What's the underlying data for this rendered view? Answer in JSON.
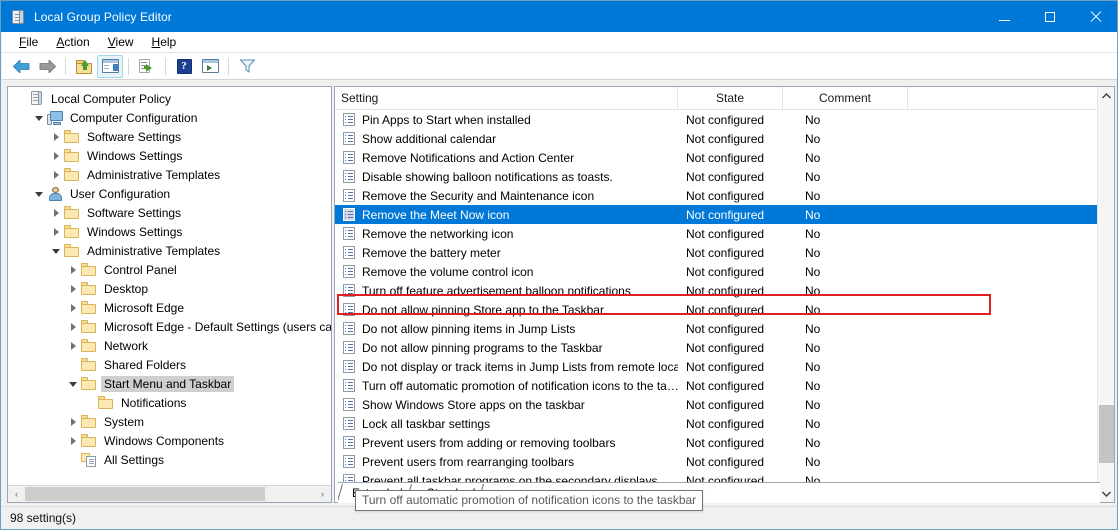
{
  "window": {
    "title": "Local Group Policy Editor",
    "icon": "gpedit-scroll-icon",
    "controls": {
      "minimize": "minimize-icon",
      "maximize": "maximize-icon",
      "close": "close-icon"
    },
    "accent": "#0078d7"
  },
  "menubar": {
    "items": [
      {
        "label": "File",
        "accel": "F"
      },
      {
        "label": "Action",
        "accel": "A"
      },
      {
        "label": "View",
        "accel": "V"
      },
      {
        "label": "Help",
        "accel": "H"
      }
    ]
  },
  "toolbar": {
    "buttons": [
      {
        "name": "back-arrow-icon",
        "tip": "Back"
      },
      {
        "name": "forward-arrow-icon",
        "tip": "Forward"
      },
      {
        "name": "up-one-level-icon",
        "tip": "Up one level"
      },
      {
        "name": "show-hide-console-tree-icon",
        "tip": "Show/Hide Console Tree",
        "active": true
      },
      {
        "name": "export-list-icon",
        "tip": "Export List"
      },
      {
        "name": "help-icon",
        "tip": "Help",
        "glyph": "?"
      },
      {
        "name": "show-action-pane-icon",
        "tip": "Show/Hide Action Pane"
      },
      {
        "name": "filter-icon",
        "tip": "Filter"
      }
    ]
  },
  "tree": {
    "nodes": [
      {
        "label": "Local Computer Policy",
        "depth": 0,
        "icon": "scroll-icon",
        "expander": "none",
        "selected": false
      },
      {
        "label": "Computer Configuration",
        "depth": 1,
        "icon": "computer-icon",
        "expander": "open",
        "selected": false
      },
      {
        "label": "Software Settings",
        "depth": 2,
        "icon": "folder-icon",
        "expander": "closed",
        "selected": false
      },
      {
        "label": "Windows Settings",
        "depth": 2,
        "icon": "folder-icon",
        "expander": "closed",
        "selected": false
      },
      {
        "label": "Administrative Templates",
        "depth": 2,
        "icon": "folder-icon",
        "expander": "closed",
        "selected": false
      },
      {
        "label": "User Configuration",
        "depth": 1,
        "icon": "user-icon",
        "expander": "open",
        "selected": false
      },
      {
        "label": "Software Settings",
        "depth": 2,
        "icon": "folder-icon",
        "expander": "closed",
        "selected": false
      },
      {
        "label": "Windows Settings",
        "depth": 2,
        "icon": "folder-icon",
        "expander": "closed",
        "selected": false
      },
      {
        "label": "Administrative Templates",
        "depth": 2,
        "icon": "folder-icon",
        "expander": "open",
        "selected": false
      },
      {
        "label": "Control Panel",
        "depth": 3,
        "icon": "folder-icon",
        "expander": "closed",
        "selected": false
      },
      {
        "label": "Desktop",
        "depth": 3,
        "icon": "folder-icon",
        "expander": "closed",
        "selected": false
      },
      {
        "label": "Microsoft Edge",
        "depth": 3,
        "icon": "folder-icon",
        "expander": "closed",
        "selected": false
      },
      {
        "label": "Microsoft Edge - Default Settings (users can c",
        "depth": 3,
        "icon": "folder-icon",
        "expander": "closed",
        "selected": false
      },
      {
        "label": "Network",
        "depth": 3,
        "icon": "folder-icon",
        "expander": "closed",
        "selected": false
      },
      {
        "label": "Shared Folders",
        "depth": 3,
        "icon": "folder-icon",
        "expander": "none",
        "selected": false
      },
      {
        "label": "Start Menu and Taskbar",
        "depth": 3,
        "icon": "folder-icon",
        "expander": "open",
        "selected": true
      },
      {
        "label": "Notifications",
        "depth": 4,
        "icon": "folder-icon",
        "expander": "none",
        "selected": false
      },
      {
        "label": "System",
        "depth": 3,
        "icon": "folder-icon",
        "expander": "closed",
        "selected": false
      },
      {
        "label": "Windows Components",
        "depth": 3,
        "icon": "folder-icon",
        "expander": "closed",
        "selected": false
      },
      {
        "label": "All Settings",
        "depth": 3,
        "icon": "all-settings-icon",
        "expander": "none",
        "selected": false
      }
    ],
    "hscroll": {
      "left_arrow": "‹",
      "right_arrow": "›"
    }
  },
  "list": {
    "columns": [
      "Setting",
      "State",
      "Comment"
    ],
    "rows": [
      {
        "setting": "Pin Apps to Start when installed",
        "state": "Not configured",
        "comment": "No",
        "selected": false
      },
      {
        "setting": "Show additional calendar",
        "state": "Not configured",
        "comment": "No",
        "selected": false
      },
      {
        "setting": "Remove Notifications and Action Center",
        "state": "Not configured",
        "comment": "No",
        "selected": false
      },
      {
        "setting": "Disable showing balloon notifications as toasts.",
        "state": "Not configured",
        "comment": "No",
        "selected": false
      },
      {
        "setting": "Remove the Security and Maintenance icon",
        "state": "Not configured",
        "comment": "No",
        "selected": false
      },
      {
        "setting": "Remove the Meet Now icon",
        "state": "Not configured",
        "comment": "No",
        "selected": true
      },
      {
        "setting": "Remove the networking icon",
        "state": "Not configured",
        "comment": "No",
        "selected": false
      },
      {
        "setting": "Remove the battery meter",
        "state": "Not configured",
        "comment": "No",
        "selected": false
      },
      {
        "setting": "Remove the volume control icon",
        "state": "Not configured",
        "comment": "No",
        "selected": false
      },
      {
        "setting": "Turn off feature advertisement balloon notifications",
        "state": "Not configured",
        "comment": "No",
        "selected": false
      },
      {
        "setting": "Do not allow pinning Store app to the Taskbar",
        "state": "Not configured",
        "comment": "No",
        "selected": false
      },
      {
        "setting": "Do not allow pinning items in Jump Lists",
        "state": "Not configured",
        "comment": "No",
        "selected": false
      },
      {
        "setting": "Do not allow pinning programs to the Taskbar",
        "state": "Not configured",
        "comment": "No",
        "selected": false
      },
      {
        "setting": "Do not display or track items in Jump Lists from remote loca…",
        "state": "Not configured",
        "comment": "No",
        "selected": false
      },
      {
        "setting": "Turn off automatic promotion of notification icons to the ta…",
        "state": "Not configured",
        "comment": "No",
        "selected": false
      },
      {
        "setting": "Show Windows Store apps on the taskbar",
        "state": "Not configured",
        "comment": "No",
        "selected": false
      },
      {
        "setting": "Lock all taskbar settings",
        "state": "Not configured",
        "comment": "No",
        "selected": false
      },
      {
        "setting": "Prevent users from adding or removing toolbars",
        "state": "Not configured",
        "comment": "No",
        "selected": false
      },
      {
        "setting": "Prevent users from rearranging toolbars",
        "state": "Not configured",
        "comment": "No",
        "selected": false
      },
      {
        "setting": "Prevent all taskbar programs on the secondary displays",
        "state": "Not configured",
        "comment": "No",
        "selected": false
      }
    ],
    "tooltip": "Turn off automatic promotion of notification icons to the taskbar",
    "highlight_color": "#e02020",
    "selection_color": "#0078d7",
    "scroll": {
      "up_arrow": "⌃",
      "down_arrow": "⌄"
    }
  },
  "tabs": [
    {
      "label": "Extended",
      "active": false
    },
    {
      "label": "Standard",
      "active": true
    }
  ],
  "status": {
    "text": "98 setting(s)"
  }
}
